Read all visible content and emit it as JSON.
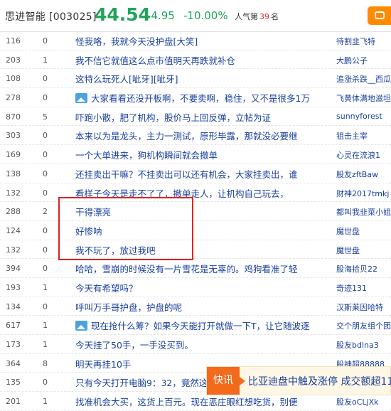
{
  "header": {
    "stock_name": "思进智能",
    "stock_code": "[003025]",
    "price": "44.54",
    "change": "-4.95",
    "change_pct": "-10.00%",
    "popularity_label": "人气第",
    "popularity_rank": "39",
    "popularity_unit": "名"
  },
  "rows": [
    {
      "reads": "116",
      "replies": "0",
      "title": "怪我咯，我就今天没护盘[大笑]",
      "author": "待割韭飞特",
      "has_image": false
    },
    {
      "reads": "203",
      "replies": "1",
      "title": "我不信它就值这么点市值明天再跌就补仓",
      "author": "大鹏公子",
      "has_image": false
    },
    {
      "reads": "108",
      "replies": "0",
      "title": "这特么玩死人[呲牙][呲牙]",
      "author": "追涨杀跌__西瓜",
      "has_image": false
    },
    {
      "reads": "278",
      "replies": "0",
      "title": "大家看看还没开板啊，不要卖啊，稳住，又不是很多1万",
      "author": "飞黄体满地滋坦",
      "has_image": true
    },
    {
      "reads": "870",
      "replies": "5",
      "title": "吓跑小散，肥了机构，股价马上回反弹，立帖为证",
      "author": "sunnyforest",
      "has_image": false
    },
    {
      "reads": "303",
      "replies": "0",
      "title": "本来以为是龙头，主力一测试，原形毕露，那就没必要继",
      "author": "狙击主宰",
      "has_image": false
    },
    {
      "reads": "169",
      "replies": "0",
      "title": "一个大单进来，狗机构瞬间就会撤单",
      "author": "心灵在流浪1",
      "has_image": false
    },
    {
      "reads": "138",
      "replies": "0",
      "title": "还挂卖出干嘛？不挂卖出可以还有机会，大家挂卖出，谁",
      "author": "股友zftBaw",
      "has_image": false
    },
    {
      "reads": "132",
      "replies": "0",
      "title": "看样子今天是走不了了，撤单走人，让机构自己玩去，",
      "author": "财神2017tmkj",
      "has_image": false
    },
    {
      "reads": "288",
      "replies": "2",
      "title": "干得漂亮",
      "author": "都叫我韭菜小姐姐",
      "has_image": false
    },
    {
      "reads": "124",
      "replies": "0",
      "title": "好惨呐",
      "author": "魔世盘",
      "has_image": false
    },
    {
      "reads": "132",
      "replies": "0",
      "title": "我不玩了，放过我吧",
      "author": "魔世盘",
      "has_image": false
    },
    {
      "reads": "394",
      "replies": "0",
      "title": "哈哈，雪崩的时候没有一片雪花是无辜的。鸡狗看准了轻",
      "author": "股海拾贝22",
      "has_image": false
    },
    {
      "reads": "193",
      "replies": "1",
      "title": "今天有希望吗？",
      "author": "奇迹131",
      "has_image": false
    },
    {
      "reads": "134",
      "replies": "0",
      "title": "呼叫万手哥护盘，护盘的呢",
      "author": "汉斯莱因哈特",
      "has_image": false
    },
    {
      "reads": "617",
      "replies": "1",
      "title": "现在抢什么筹？如果今天能打开就做一下T，让它随波逐",
      "author": "交个朋友组个团",
      "has_image": true
    },
    {
      "reads": "173",
      "replies": "1",
      "title": "今天挂了50手，一手没买到。",
      "author": "股友bdlna3",
      "has_image": false
    },
    {
      "reads": "364",
      "replies": "8",
      "title": "明天再挂10手",
      "author": "股神超88888",
      "has_image": false
    },
    {
      "reads": "135",
      "replies": "0",
      "title": "只有今天打开电脑9：32，竟然这样",
      "author": "",
      "has_image": false
    },
    {
      "reads": "201",
      "replies": "1",
      "title": "找准机会大买，这货上百元。现在恶庄眼红想吃货，别便",
      "author": "股友oCLjXk",
      "has_image": false
    }
  ],
  "toast": {
    "tag": "快讯",
    "text": "比亚迪盘中触及涨停 成交额超11"
  }
}
